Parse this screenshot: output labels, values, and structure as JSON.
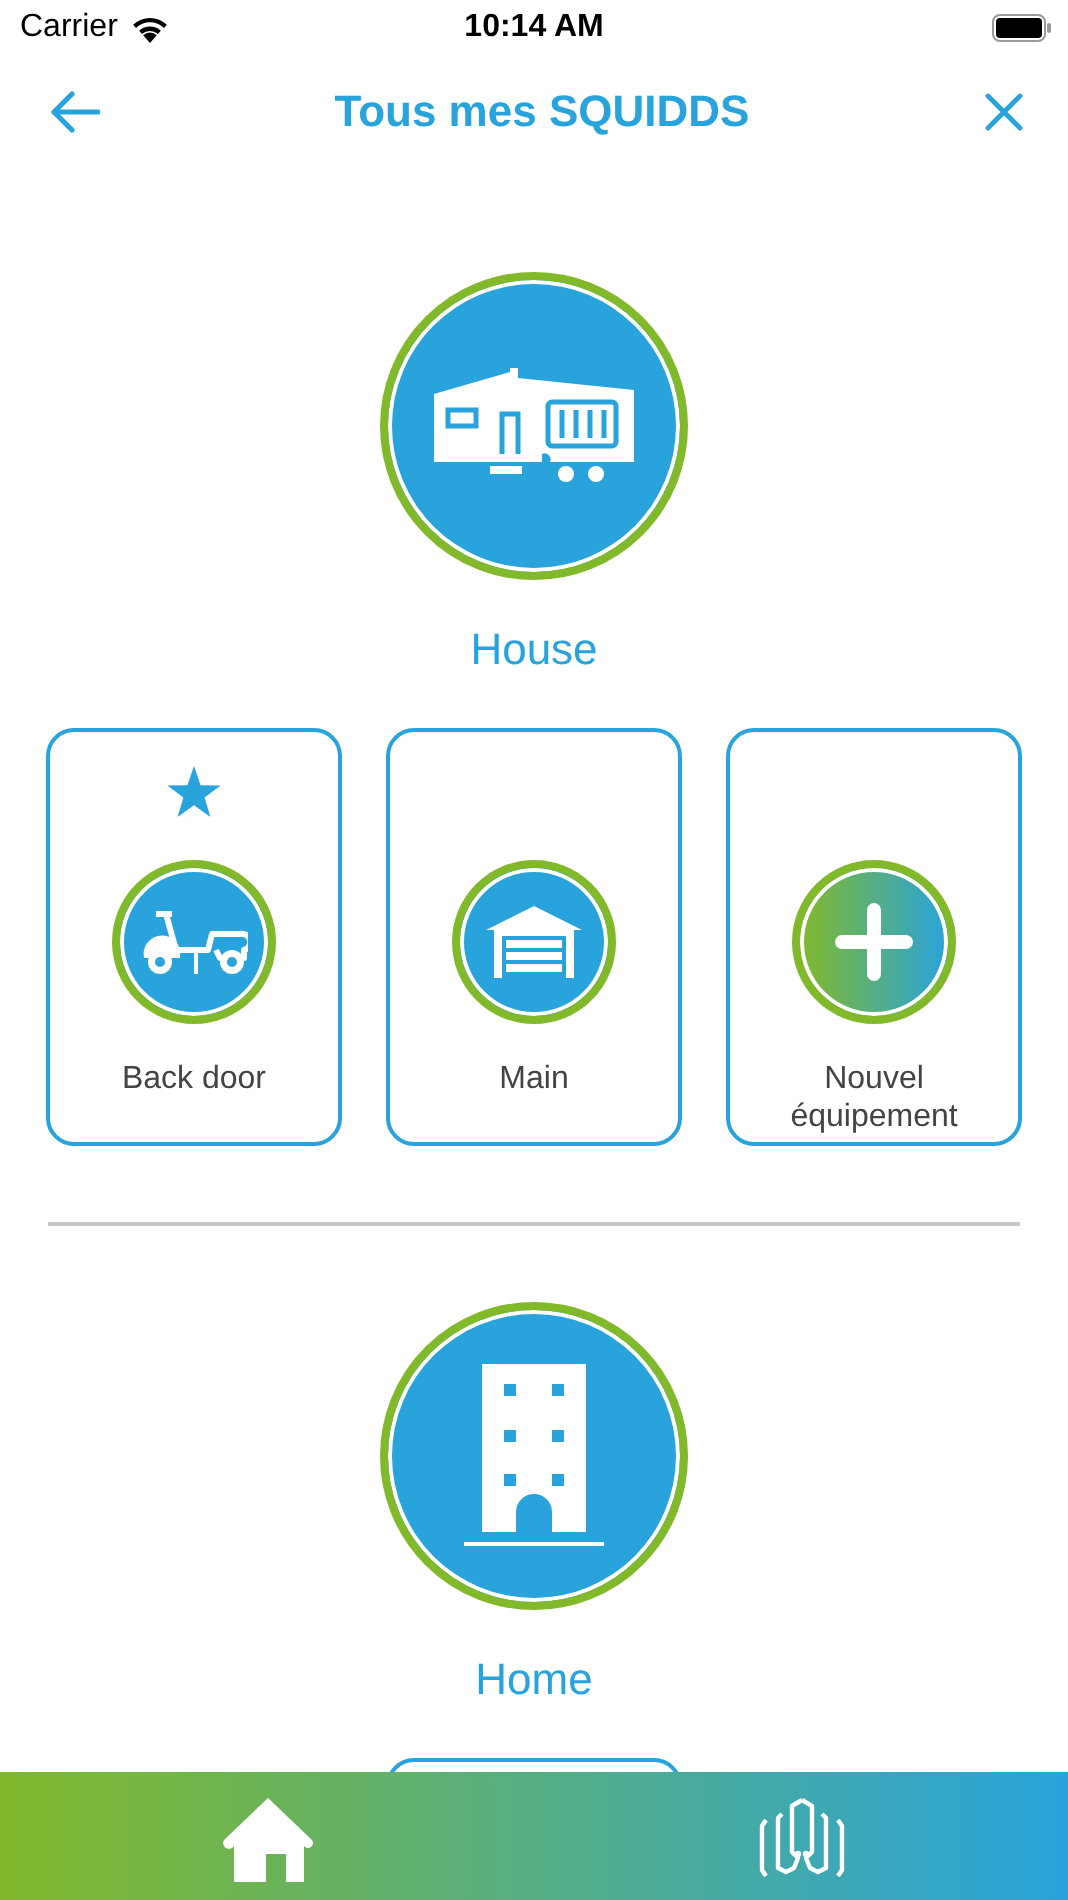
{
  "status_bar": {
    "carrier": "Carrier",
    "time": "10:14 AM"
  },
  "nav": {
    "title": "Tous mes SQUIDDS"
  },
  "groups": [
    {
      "name": "House",
      "devices": [
        {
          "kind": "scooter",
          "name": "Back door",
          "favorite": true
        },
        {
          "kind": "garage",
          "name": "Main",
          "favorite": false
        },
        {
          "kind": "add",
          "name": "Nouvel équipement",
          "favorite": false
        }
      ]
    },
    {
      "name": "Home",
      "devices": [
        {
          "kind": "partial"
        }
      ]
    }
  ]
}
